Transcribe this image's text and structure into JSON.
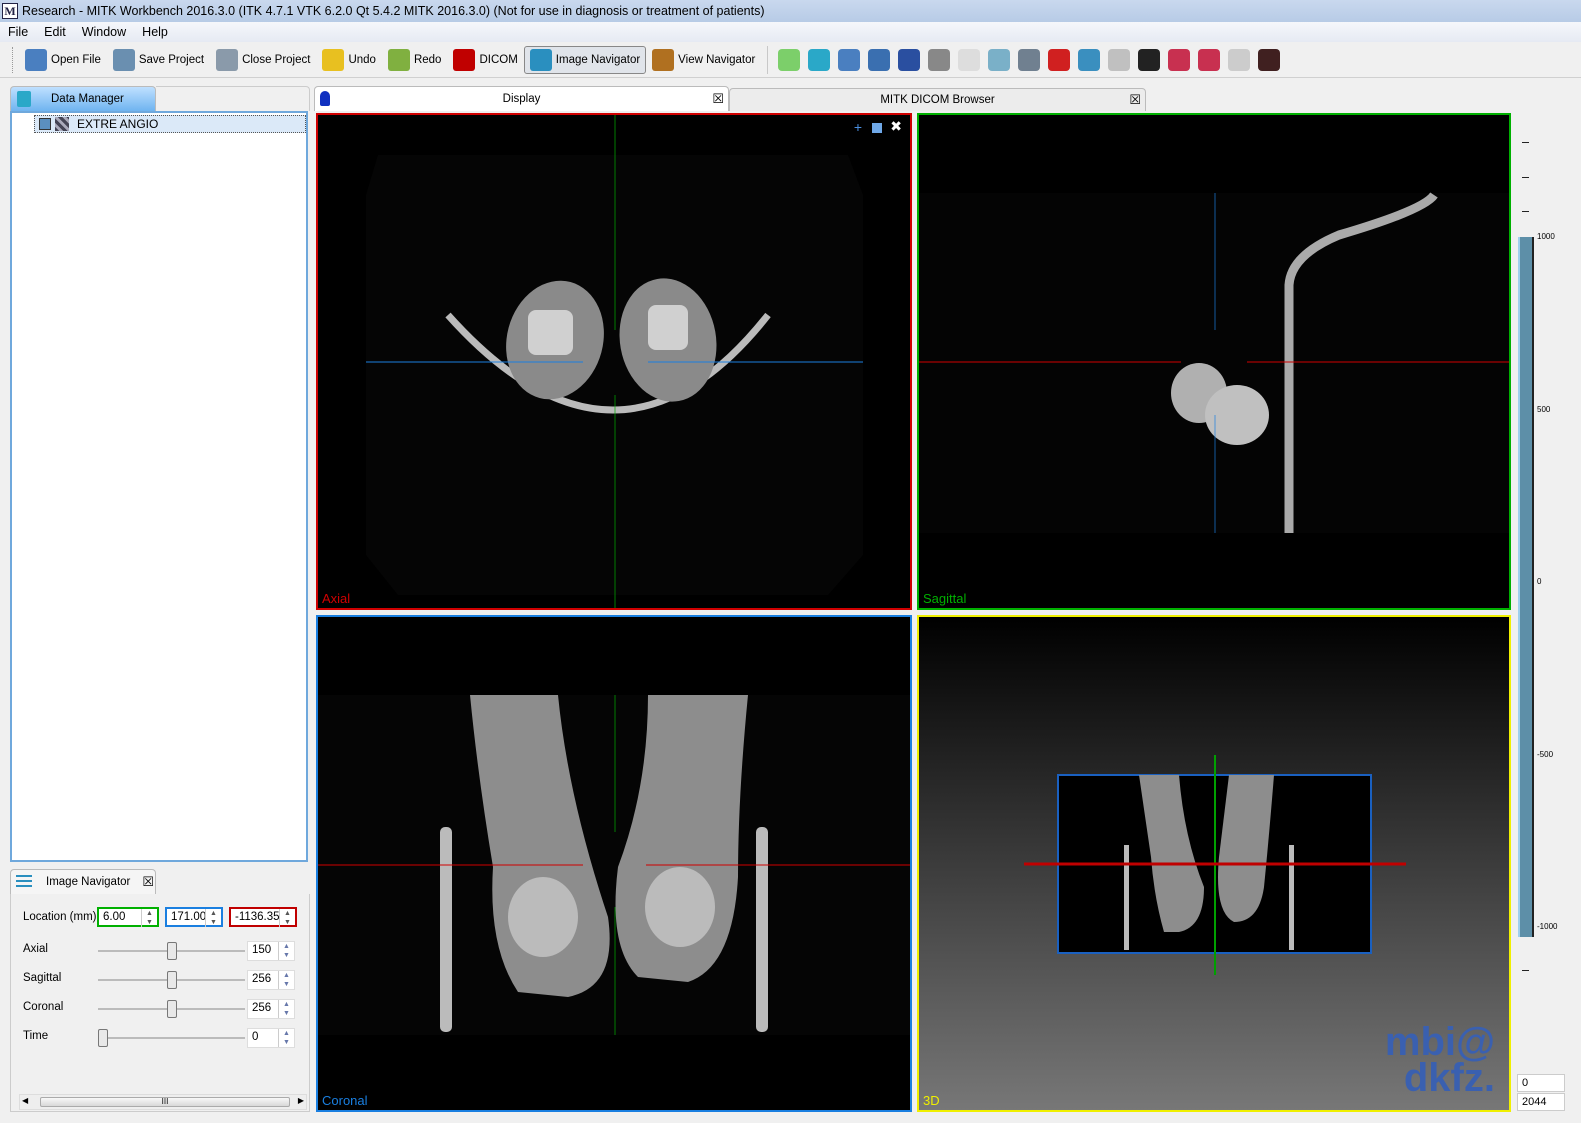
{
  "window": {
    "title": "Research - MITK Workbench 2016.3.0 (ITK 4.7.1  VTK 6.2.0 Qt 5.4.2 MITK 2016.3.0) (Not for use in diagnosis or treatment of patients)"
  },
  "menu": [
    "File",
    "Edit",
    "Window",
    "Help"
  ],
  "toolbar": {
    "buttons": [
      {
        "label": "Open File",
        "icon": "folder-icon",
        "color": "#4a7fc0"
      },
      {
        "label": "Save Project",
        "icon": "save-icon",
        "color": "#6a8fb0"
      },
      {
        "label": "Close Project",
        "icon": "printer-icon",
        "color": "#8a9aaa"
      },
      {
        "label": "Undo",
        "icon": "undo-icon",
        "color": "#e8c020"
      },
      {
        "label": "Redo",
        "icon": "redo-icon",
        "color": "#80b040"
      },
      {
        "label": "DICOM",
        "icon": "dicom-icon",
        "color": "#c00000"
      },
      {
        "label": "Image Navigator",
        "icon": "sliders-icon",
        "color": "#2a8fbf",
        "active": true
      },
      {
        "label": "View Navigator",
        "icon": "cabinet-icon",
        "color": "#b07020"
      }
    ],
    "tools": [
      {
        "icon": "segmentation-icon",
        "color": "#7ccf6a"
      },
      {
        "icon": "data-cabinet-icon",
        "color": "#2aa8c8"
      },
      {
        "icon": "help-icon",
        "color": "#4a7fc0"
      },
      {
        "icon": "help-list-icon",
        "color": "#3a6fb0"
      },
      {
        "icon": "help-search-icon",
        "color": "#2a4fa0"
      },
      {
        "icon": "scissors-icon",
        "color": "#888888"
      },
      {
        "icon": "logging-icon",
        "color": "#dddddd"
      },
      {
        "icon": "measurement-icon",
        "color": "#7ab0c8"
      },
      {
        "icon": "camera-icon",
        "color": "#708090"
      },
      {
        "icon": "pin-icon",
        "color": "#d02020"
      },
      {
        "icon": "zoom-icon",
        "color": "#3a8fbf"
      },
      {
        "icon": "rabbit-icon",
        "color": "#c0c0c0"
      },
      {
        "icon": "screenshot-icon",
        "color": "#222222"
      },
      {
        "icon": "pixel-lasso-icon",
        "color": "#c83050"
      },
      {
        "icon": "pixel-tools-icon",
        "color": "#c83050"
      },
      {
        "icon": "histogram-icon",
        "color": "#cccccc"
      },
      {
        "icon": "eye-icon",
        "color": "#402020"
      }
    ]
  },
  "data_manager": {
    "tab": "Data Manager",
    "items": [
      "EXTRE ANGIO"
    ]
  },
  "image_navigator": {
    "tab": "Image Navigator",
    "location_label": "Location (mm)",
    "location": [
      "6.00",
      "171.00",
      "-1136.35"
    ],
    "sliders": [
      {
        "label": "Axial",
        "value": "150",
        "fraction": 0.5
      },
      {
        "label": "Sagittal",
        "value": "256",
        "fraction": 0.5
      },
      {
        "label": "Coronal",
        "value": "256",
        "fraction": 0.5
      },
      {
        "label": "Time",
        "value": "0",
        "fraction": 0
      }
    ],
    "scroll_thumb": "III"
  },
  "editor_tabs": [
    "Display",
    "MITK DICOM Browser"
  ],
  "views": {
    "axial": "Axial",
    "sagittal": "Sagittal",
    "coronal": "Coronal",
    "threed": "3D"
  },
  "colors": {
    "axial": "#d00000",
    "sagittal": "#00b000",
    "coronal": "#1a7fe0",
    "threed": "#f0f000"
  },
  "level_window": {
    "ticks": [
      "1000",
      "500",
      "0",
      "-500",
      "-1000"
    ],
    "level": "0",
    "window": "2044"
  },
  "logo": "mbi@ dkfz."
}
